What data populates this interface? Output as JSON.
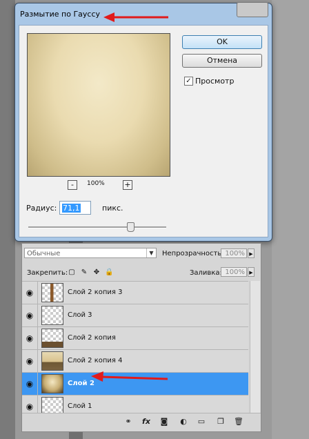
{
  "dialog": {
    "title": "Размытие по Гауссу",
    "ok_label": "OK",
    "cancel_label": "Отмена",
    "preview_label": "Просмотр",
    "preview_checked": true,
    "zoom_minus": "-",
    "zoom_plus": "+",
    "zoom_value": "100%",
    "radius_label": "Радиус:",
    "radius_value": "71,1",
    "radius_unit": "пикс."
  },
  "layers_panel": {
    "blend_mode": "Обычные",
    "opacity_label": "Непрозрачность:",
    "opacity_value": "100%",
    "lock_label": "Закрепить:",
    "fill_label": "Заливка:",
    "fill_value": "100%",
    "layers": [
      {
        "name": "Слой 2 копия 3",
        "selected": false,
        "thumb": "figure"
      },
      {
        "name": "Слой 3",
        "selected": false,
        "thumb": "transparent"
      },
      {
        "name": "Слой 2 копия",
        "selected": false,
        "thumb": "rock"
      },
      {
        "name": "Слой 2 копия 4",
        "selected": false,
        "thumb": "photo"
      },
      {
        "name": "Слой 2",
        "selected": true,
        "thumb": "blur"
      },
      {
        "name": "Слой 1",
        "selected": false,
        "thumb": "transparent"
      }
    ],
    "bottom_icons": [
      "link-icon",
      "fx-icon",
      "mask-icon",
      "adjustment-icon",
      "folder-icon",
      "new-layer-icon",
      "trash-icon"
    ],
    "bottom_labels": {
      "fx": "fx"
    }
  },
  "colors": {
    "selected_row": "#3d97f2",
    "arrow_red": "#e11b1b",
    "dialog_frame": "#a9c7e6"
  }
}
